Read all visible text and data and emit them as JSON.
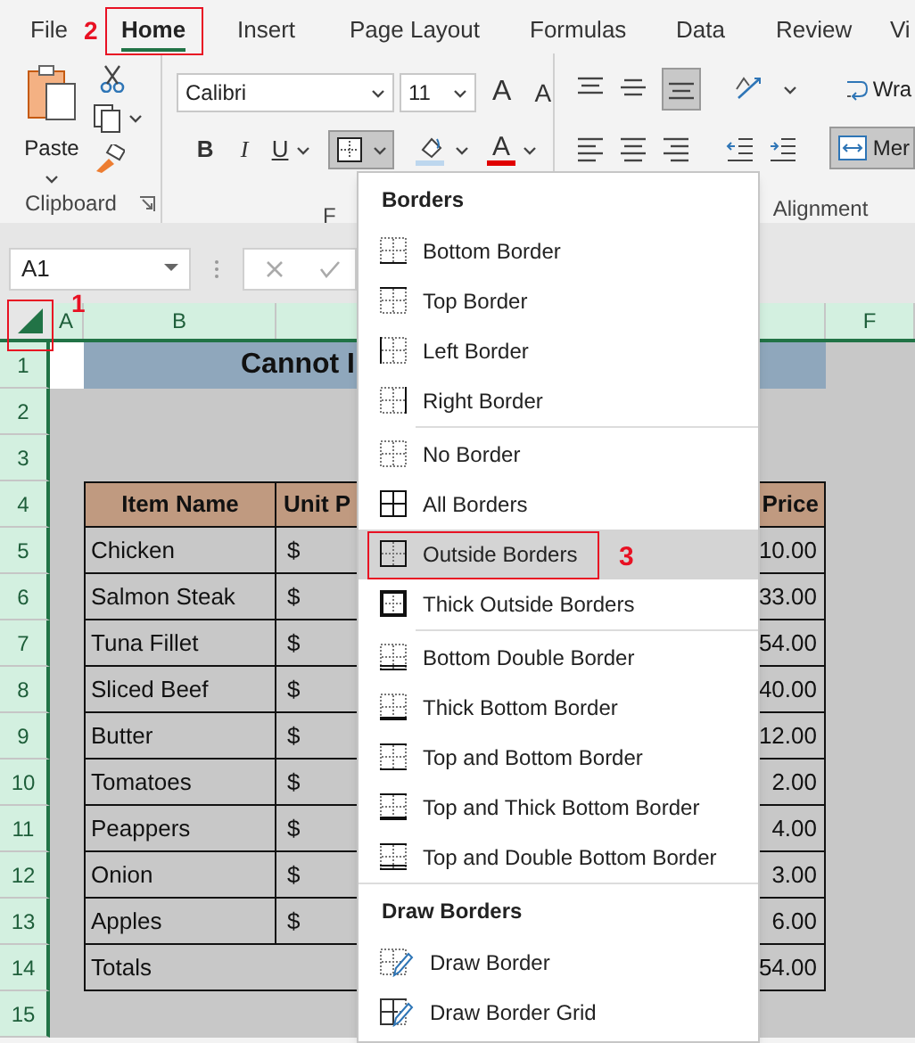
{
  "tabs": [
    {
      "label": "File",
      "selected": false
    },
    {
      "label": "Home",
      "selected": true
    },
    {
      "label": "Insert",
      "selected": false
    },
    {
      "label": "Page Layout",
      "selected": false
    },
    {
      "label": "Formulas",
      "selected": false
    },
    {
      "label": "Data",
      "selected": false
    },
    {
      "label": "Review",
      "selected": false
    },
    {
      "label": "Vi",
      "selected": false
    }
  ],
  "ribbon": {
    "clipboard": {
      "paste_label": "Paste",
      "group_label": "Clipboard"
    },
    "font": {
      "font_name": "Calibri",
      "font_size": "11",
      "grow": "A",
      "shrink": "A",
      "bold": "B",
      "italic": "I",
      "underline": "U",
      "font_color": "A",
      "group_label": "F"
    },
    "alignment": {
      "wrap_label": "Wra",
      "merge_label": "Mer",
      "group_label": "Alignment"
    }
  },
  "name_box": "A1",
  "column_headers": [
    {
      "label": "A",
      "selected": true
    },
    {
      "label": "B",
      "selected": true
    },
    {
      "label": "F",
      "selected": true
    }
  ],
  "row_headers": [
    {
      "label": "1",
      "selected": true
    },
    {
      "label": "2",
      "selected": true
    },
    {
      "label": "3",
      "selected": true
    },
    {
      "label": "4",
      "selected": true
    },
    {
      "label": "5",
      "selected": true
    },
    {
      "label": "6",
      "selected": true
    },
    {
      "label": "7",
      "selected": true
    },
    {
      "label": "8",
      "selected": true
    },
    {
      "label": "9",
      "selected": true
    },
    {
      "label": "10",
      "selected": true
    },
    {
      "label": "11",
      "selected": true
    },
    {
      "label": "12",
      "selected": true
    },
    {
      "label": "13",
      "selected": true
    },
    {
      "label": "14",
      "selected": true
    },
    {
      "label": "15",
      "selected": true
    }
  ],
  "sheet_title": "Cannot I",
  "table": {
    "columns": [
      "Item Name",
      "Unit P",
      "Price"
    ],
    "rows": [
      {
        "item": "Chicken",
        "unit": "$",
        "price": "10.00"
      },
      {
        "item": "Salmon Steak",
        "unit": "$",
        "price": "33.00"
      },
      {
        "item": "Tuna Fillet",
        "unit": "$",
        "price": "54.00"
      },
      {
        "item": "Sliced Beef",
        "unit": "$",
        "price": "40.00"
      },
      {
        "item": "Butter",
        "unit": "$",
        "price": "12.00"
      },
      {
        "item": "Tomatoes",
        "unit": "$",
        "price": "2.00"
      },
      {
        "item": "Peappers",
        "unit": "$",
        "price": "4.00"
      },
      {
        "item": "Onion",
        "unit": "$",
        "price": "3.00"
      },
      {
        "item": "Apples",
        "unit": "$",
        "price": "6.00"
      }
    ],
    "total": {
      "label": "Totals",
      "price": "54.00"
    }
  },
  "menu": {
    "sections": [
      {
        "title": "Borders",
        "groups": [
          [
            {
              "label": "Bottom Border",
              "kind": "bottom",
              "selected": false
            },
            {
              "label": "Top Border",
              "kind": "top",
              "selected": false
            },
            {
              "label": "Left Border",
              "kind": "left",
              "selected": false
            },
            {
              "label": "Right Border",
              "kind": "right",
              "selected": false
            }
          ],
          [
            {
              "label": "No Border",
              "kind": "none",
              "selected": false
            },
            {
              "label": "All Borders",
              "kind": "all",
              "selected": false
            },
            {
              "label": "Outside Borders",
              "kind": "outside",
              "selected": true
            },
            {
              "label": "Thick Outside Borders",
              "kind": "thick-outside",
              "selected": false
            }
          ],
          [
            {
              "label": "Bottom Double Border",
              "kind": "bottom-double",
              "selected": false
            },
            {
              "label": "Thick Bottom Border",
              "kind": "thick-bottom",
              "selected": false
            },
            {
              "label": "Top and Bottom Border",
              "kind": "top-bottom",
              "selected": false
            },
            {
              "label": "Top and Thick Bottom Border",
              "kind": "top-thick-bottom",
              "selected": false
            },
            {
              "label": "Top and Double Bottom Border",
              "kind": "top-double-bottom",
              "selected": false
            }
          ]
        ]
      },
      {
        "title": "Draw Borders",
        "groups": [
          [
            {
              "label": "Draw Border",
              "kind": "draw",
              "selected": false
            },
            {
              "label": "Draw Border Grid",
              "kind": "draw-grid",
              "selected": false
            }
          ]
        ]
      }
    ]
  },
  "annotations": [
    {
      "label": "1"
    },
    {
      "label": "2"
    },
    {
      "label": "3"
    }
  ]
}
